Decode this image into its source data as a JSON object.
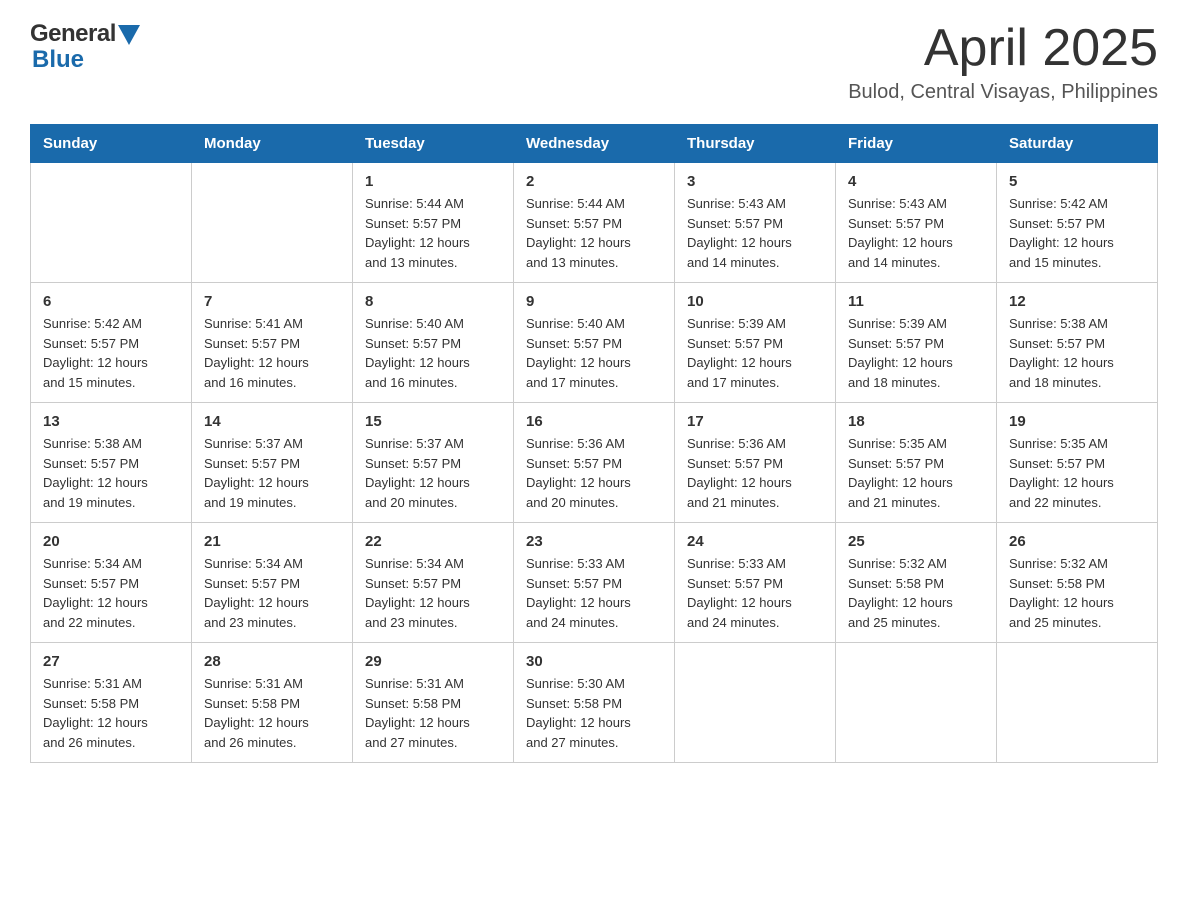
{
  "header": {
    "logo_general": "General",
    "logo_blue": "Blue",
    "title": "April 2025",
    "subtitle": "Bulod, Central Visayas, Philippines"
  },
  "calendar": {
    "days_of_week": [
      "Sunday",
      "Monday",
      "Tuesday",
      "Wednesday",
      "Thursday",
      "Friday",
      "Saturday"
    ],
    "weeks": [
      [
        {
          "day": "",
          "info": ""
        },
        {
          "day": "",
          "info": ""
        },
        {
          "day": "1",
          "info": "Sunrise: 5:44 AM\nSunset: 5:57 PM\nDaylight: 12 hours\nand 13 minutes."
        },
        {
          "day": "2",
          "info": "Sunrise: 5:44 AM\nSunset: 5:57 PM\nDaylight: 12 hours\nand 13 minutes."
        },
        {
          "day": "3",
          "info": "Sunrise: 5:43 AM\nSunset: 5:57 PM\nDaylight: 12 hours\nand 14 minutes."
        },
        {
          "day": "4",
          "info": "Sunrise: 5:43 AM\nSunset: 5:57 PM\nDaylight: 12 hours\nand 14 minutes."
        },
        {
          "day": "5",
          "info": "Sunrise: 5:42 AM\nSunset: 5:57 PM\nDaylight: 12 hours\nand 15 minutes."
        }
      ],
      [
        {
          "day": "6",
          "info": "Sunrise: 5:42 AM\nSunset: 5:57 PM\nDaylight: 12 hours\nand 15 minutes."
        },
        {
          "day": "7",
          "info": "Sunrise: 5:41 AM\nSunset: 5:57 PM\nDaylight: 12 hours\nand 16 minutes."
        },
        {
          "day": "8",
          "info": "Sunrise: 5:40 AM\nSunset: 5:57 PM\nDaylight: 12 hours\nand 16 minutes."
        },
        {
          "day": "9",
          "info": "Sunrise: 5:40 AM\nSunset: 5:57 PM\nDaylight: 12 hours\nand 17 minutes."
        },
        {
          "day": "10",
          "info": "Sunrise: 5:39 AM\nSunset: 5:57 PM\nDaylight: 12 hours\nand 17 minutes."
        },
        {
          "day": "11",
          "info": "Sunrise: 5:39 AM\nSunset: 5:57 PM\nDaylight: 12 hours\nand 18 minutes."
        },
        {
          "day": "12",
          "info": "Sunrise: 5:38 AM\nSunset: 5:57 PM\nDaylight: 12 hours\nand 18 minutes."
        }
      ],
      [
        {
          "day": "13",
          "info": "Sunrise: 5:38 AM\nSunset: 5:57 PM\nDaylight: 12 hours\nand 19 minutes."
        },
        {
          "day": "14",
          "info": "Sunrise: 5:37 AM\nSunset: 5:57 PM\nDaylight: 12 hours\nand 19 minutes."
        },
        {
          "day": "15",
          "info": "Sunrise: 5:37 AM\nSunset: 5:57 PM\nDaylight: 12 hours\nand 20 minutes."
        },
        {
          "day": "16",
          "info": "Sunrise: 5:36 AM\nSunset: 5:57 PM\nDaylight: 12 hours\nand 20 minutes."
        },
        {
          "day": "17",
          "info": "Sunrise: 5:36 AM\nSunset: 5:57 PM\nDaylight: 12 hours\nand 21 minutes."
        },
        {
          "day": "18",
          "info": "Sunrise: 5:35 AM\nSunset: 5:57 PM\nDaylight: 12 hours\nand 21 minutes."
        },
        {
          "day": "19",
          "info": "Sunrise: 5:35 AM\nSunset: 5:57 PM\nDaylight: 12 hours\nand 22 minutes."
        }
      ],
      [
        {
          "day": "20",
          "info": "Sunrise: 5:34 AM\nSunset: 5:57 PM\nDaylight: 12 hours\nand 22 minutes."
        },
        {
          "day": "21",
          "info": "Sunrise: 5:34 AM\nSunset: 5:57 PM\nDaylight: 12 hours\nand 23 minutes."
        },
        {
          "day": "22",
          "info": "Sunrise: 5:34 AM\nSunset: 5:57 PM\nDaylight: 12 hours\nand 23 minutes."
        },
        {
          "day": "23",
          "info": "Sunrise: 5:33 AM\nSunset: 5:57 PM\nDaylight: 12 hours\nand 24 minutes."
        },
        {
          "day": "24",
          "info": "Sunrise: 5:33 AM\nSunset: 5:57 PM\nDaylight: 12 hours\nand 24 minutes."
        },
        {
          "day": "25",
          "info": "Sunrise: 5:32 AM\nSunset: 5:58 PM\nDaylight: 12 hours\nand 25 minutes."
        },
        {
          "day": "26",
          "info": "Sunrise: 5:32 AM\nSunset: 5:58 PM\nDaylight: 12 hours\nand 25 minutes."
        }
      ],
      [
        {
          "day": "27",
          "info": "Sunrise: 5:31 AM\nSunset: 5:58 PM\nDaylight: 12 hours\nand 26 minutes."
        },
        {
          "day": "28",
          "info": "Sunrise: 5:31 AM\nSunset: 5:58 PM\nDaylight: 12 hours\nand 26 minutes."
        },
        {
          "day": "29",
          "info": "Sunrise: 5:31 AM\nSunset: 5:58 PM\nDaylight: 12 hours\nand 27 minutes."
        },
        {
          "day": "30",
          "info": "Sunrise: 5:30 AM\nSunset: 5:58 PM\nDaylight: 12 hours\nand 27 minutes."
        },
        {
          "day": "",
          "info": ""
        },
        {
          "day": "",
          "info": ""
        },
        {
          "day": "",
          "info": ""
        }
      ]
    ]
  }
}
